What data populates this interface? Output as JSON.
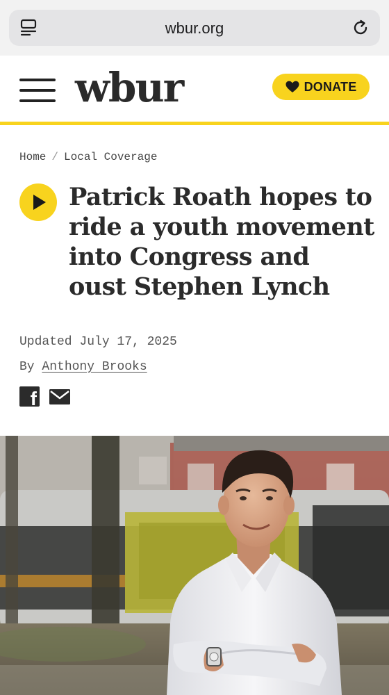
{
  "browser": {
    "url": "wbur.org",
    "reader_icon": "reader-mode-icon",
    "reload_icon": "reload-icon"
  },
  "header": {
    "logo": "wbur",
    "donate_label": "DONATE",
    "menu_icon": "hamburger-menu-icon",
    "accent_color": "#f8d31e"
  },
  "breadcrumb": {
    "items": [
      "Home",
      "Local Coverage"
    ],
    "separator": "/"
  },
  "article": {
    "headline": "Patrick Roath hopes to ride a youth movement into Congress and oust Stephen Lynch",
    "updated": "Updated July 17, 2025",
    "byline_prefix": "By",
    "author": "Anthony Brooks",
    "share": [
      "facebook-icon",
      "email-icon"
    ]
  }
}
